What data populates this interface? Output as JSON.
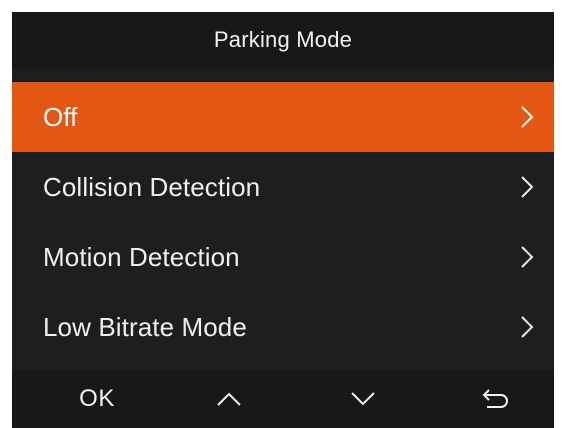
{
  "header": {
    "title": "Parking Mode"
  },
  "menu": {
    "items": [
      {
        "label": "Off",
        "selected": true,
        "icon": "chevron-right-icon"
      },
      {
        "label": "Collision Detection",
        "selected": false,
        "icon": "chevron-right-icon"
      },
      {
        "label": "Motion Detection",
        "selected": false,
        "icon": "chevron-right-icon"
      },
      {
        "label": "Low Bitrate Mode",
        "selected": false,
        "icon": "chevron-right-icon"
      }
    ]
  },
  "footer": {
    "ok_label": "OK",
    "up_icon": "chevron-up-icon",
    "down_icon": "chevron-down-icon",
    "back_icon": "return-arrow-icon"
  },
  "colors": {
    "background": "#1e1e1e",
    "bar": "#181818",
    "accent": "#e35712",
    "text": "#efefef"
  }
}
